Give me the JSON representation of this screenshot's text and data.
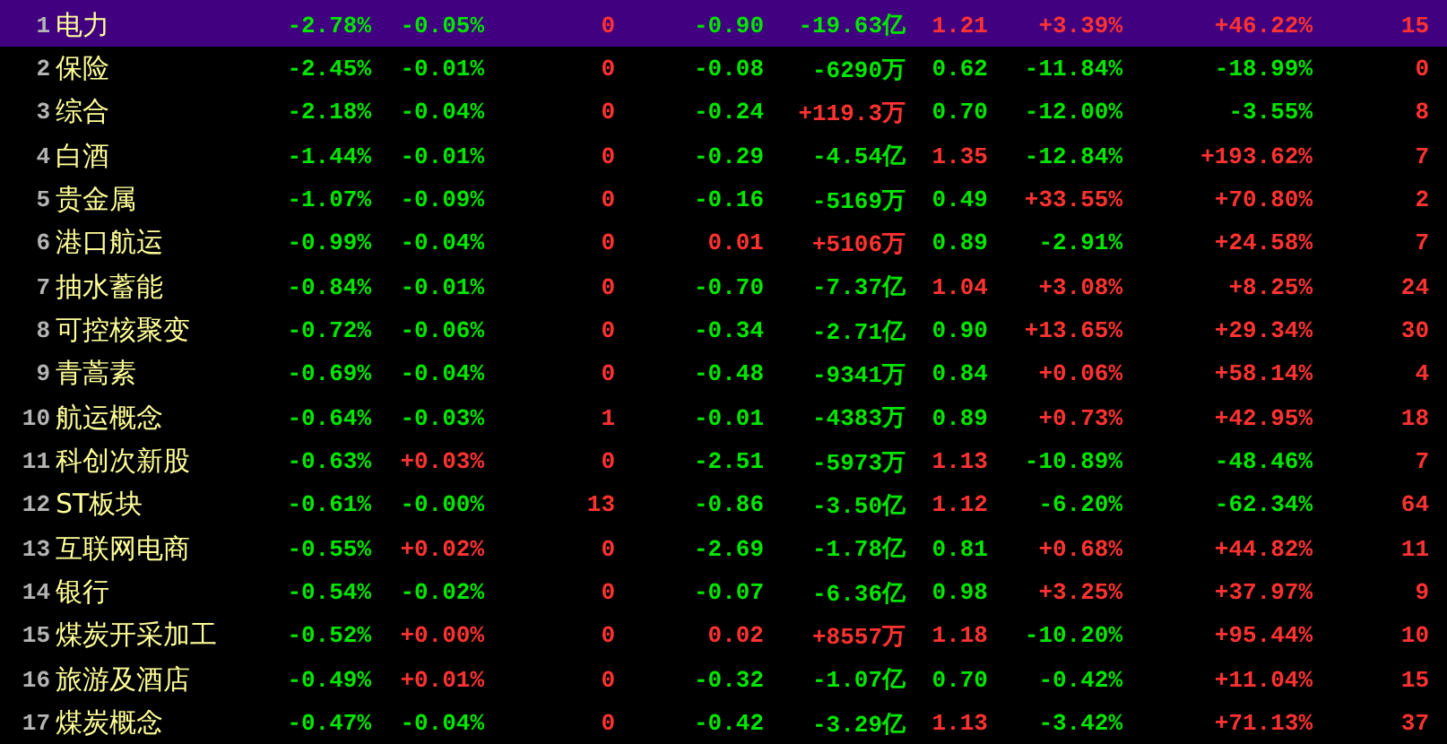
{
  "rows": [
    {
      "index": "1",
      "name": "电力",
      "selected": true,
      "cells": [
        {
          "text": "-2.78%",
          "color": "#00e600"
        },
        {
          "text": "-0.05%",
          "color": "#00e600"
        },
        {
          "text": "0",
          "color": "#ff3232"
        },
        {
          "text": "-0.90",
          "color": "#00e600"
        },
        {
          "text": "-19.63亿",
          "color": "#00e600"
        },
        {
          "text": "1.21",
          "color": "#ff3232"
        },
        {
          "text": "+3.39%",
          "color": "#ff3232"
        },
        {
          "text": "+46.22%",
          "color": "#ff3232"
        },
        {
          "text": "15",
          "color": "#ff3232"
        }
      ]
    },
    {
      "index": "2",
      "name": "保险",
      "selected": false,
      "cells": [
        {
          "text": "-2.45%",
          "color": "#00e600"
        },
        {
          "text": "-0.01%",
          "color": "#00e600"
        },
        {
          "text": "0",
          "color": "#ff3232"
        },
        {
          "text": "-0.08",
          "color": "#00e600"
        },
        {
          "text": "-6290万",
          "color": "#00e600"
        },
        {
          "text": "0.62",
          "color": "#00e600"
        },
        {
          "text": "-11.84%",
          "color": "#00e600"
        },
        {
          "text": "-18.99%",
          "color": "#00e600"
        },
        {
          "text": "0",
          "color": "#ff3232"
        }
      ]
    },
    {
      "index": "3",
      "name": "综合",
      "selected": false,
      "cells": [
        {
          "text": "-2.18%",
          "color": "#00e600"
        },
        {
          "text": "-0.04%",
          "color": "#00e600"
        },
        {
          "text": "0",
          "color": "#ff3232"
        },
        {
          "text": "-0.24",
          "color": "#00e600"
        },
        {
          "text": "+119.3万",
          "color": "#ff3232"
        },
        {
          "text": "0.70",
          "color": "#00e600"
        },
        {
          "text": "-12.00%",
          "color": "#00e600"
        },
        {
          "text": "-3.55%",
          "color": "#00e600"
        },
        {
          "text": "8",
          "color": "#ff3232"
        }
      ]
    },
    {
      "index": "4",
      "name": "白酒",
      "selected": false,
      "cells": [
        {
          "text": "-1.44%",
          "color": "#00e600"
        },
        {
          "text": "-0.01%",
          "color": "#00e600"
        },
        {
          "text": "0",
          "color": "#ff3232"
        },
        {
          "text": "-0.29",
          "color": "#00e600"
        },
        {
          "text": "-4.54亿",
          "color": "#00e600"
        },
        {
          "text": "1.35",
          "color": "#ff3232"
        },
        {
          "text": "-12.84%",
          "color": "#00e600"
        },
        {
          "text": "+193.62%",
          "color": "#ff3232"
        },
        {
          "text": "7",
          "color": "#ff3232"
        }
      ]
    },
    {
      "index": "5",
      "name": "贵金属",
      "selected": false,
      "cells": [
        {
          "text": "-1.07%",
          "color": "#00e600"
        },
        {
          "text": "-0.09%",
          "color": "#00e600"
        },
        {
          "text": "0",
          "color": "#ff3232"
        },
        {
          "text": "-0.16",
          "color": "#00e600"
        },
        {
          "text": "-5169万",
          "color": "#00e600"
        },
        {
          "text": "0.49",
          "color": "#00e600"
        },
        {
          "text": "+33.55%",
          "color": "#ff3232"
        },
        {
          "text": "+70.80%",
          "color": "#ff3232"
        },
        {
          "text": "2",
          "color": "#ff3232"
        }
      ]
    },
    {
      "index": "6",
      "name": "港口航运",
      "selected": false,
      "cells": [
        {
          "text": "-0.99%",
          "color": "#00e600"
        },
        {
          "text": "-0.04%",
          "color": "#00e600"
        },
        {
          "text": "0",
          "color": "#ff3232"
        },
        {
          "text": "0.01",
          "color": "#ff3232"
        },
        {
          "text": "+5106万",
          "color": "#ff3232"
        },
        {
          "text": "0.89",
          "color": "#00e600"
        },
        {
          "text": "-2.91%",
          "color": "#00e600"
        },
        {
          "text": "+24.58%",
          "color": "#ff3232"
        },
        {
          "text": "7",
          "color": "#ff3232"
        }
      ]
    },
    {
      "index": "7",
      "name": "抽水蓄能",
      "selected": false,
      "cells": [
        {
          "text": "-0.84%",
          "color": "#00e600"
        },
        {
          "text": "-0.01%",
          "color": "#00e600"
        },
        {
          "text": "0",
          "color": "#ff3232"
        },
        {
          "text": "-0.70",
          "color": "#00e600"
        },
        {
          "text": "-7.37亿",
          "color": "#00e600"
        },
        {
          "text": "1.04",
          "color": "#ff3232"
        },
        {
          "text": "+3.08%",
          "color": "#ff3232"
        },
        {
          "text": "+8.25%",
          "color": "#ff3232"
        },
        {
          "text": "24",
          "color": "#ff3232"
        }
      ]
    },
    {
      "index": "8",
      "name": "可控核聚变",
      "selected": false,
      "cells": [
        {
          "text": "-0.72%",
          "color": "#00e600"
        },
        {
          "text": "-0.06%",
          "color": "#00e600"
        },
        {
          "text": "0",
          "color": "#ff3232"
        },
        {
          "text": "-0.34",
          "color": "#00e600"
        },
        {
          "text": "-2.71亿",
          "color": "#00e600"
        },
        {
          "text": "0.90",
          "color": "#00e600"
        },
        {
          "text": "+13.65%",
          "color": "#ff3232"
        },
        {
          "text": "+29.34%",
          "color": "#ff3232"
        },
        {
          "text": "30",
          "color": "#ff3232"
        }
      ]
    },
    {
      "index": "9",
      "name": "青蒿素",
      "selected": false,
      "cells": [
        {
          "text": "-0.69%",
          "color": "#00e600"
        },
        {
          "text": "-0.04%",
          "color": "#00e600"
        },
        {
          "text": "0",
          "color": "#ff3232"
        },
        {
          "text": "-0.48",
          "color": "#00e600"
        },
        {
          "text": "-9341万",
          "color": "#00e600"
        },
        {
          "text": "0.84",
          "color": "#00e600"
        },
        {
          "text": "+0.06%",
          "color": "#ff3232"
        },
        {
          "text": "+58.14%",
          "color": "#ff3232"
        },
        {
          "text": "4",
          "color": "#ff3232"
        }
      ]
    },
    {
      "index": "10",
      "name": "航运概念",
      "selected": false,
      "cells": [
        {
          "text": "-0.64%",
          "color": "#00e600"
        },
        {
          "text": "-0.03%",
          "color": "#00e600"
        },
        {
          "text": "1",
          "color": "#ff3232"
        },
        {
          "text": "-0.01",
          "color": "#00e600"
        },
        {
          "text": "-4383万",
          "color": "#00e600"
        },
        {
          "text": "0.89",
          "color": "#00e600"
        },
        {
          "text": "+0.73%",
          "color": "#ff3232"
        },
        {
          "text": "+42.95%",
          "color": "#ff3232"
        },
        {
          "text": "18",
          "color": "#ff3232"
        }
      ]
    },
    {
      "index": "11",
      "name": "科创次新股",
      "selected": false,
      "cells": [
        {
          "text": "-0.63%",
          "color": "#00e600"
        },
        {
          "text": "+0.03%",
          "color": "#ff3232"
        },
        {
          "text": "0",
          "color": "#ff3232"
        },
        {
          "text": "-2.51",
          "color": "#00e600"
        },
        {
          "text": "-5973万",
          "color": "#00e600"
        },
        {
          "text": "1.13",
          "color": "#ff3232"
        },
        {
          "text": "-10.89%",
          "color": "#00e600"
        },
        {
          "text": "-48.46%",
          "color": "#00e600"
        },
        {
          "text": "7",
          "color": "#ff3232"
        }
      ]
    },
    {
      "index": "12",
      "name": "ST板块",
      "selected": false,
      "cells": [
        {
          "text": "-0.61%",
          "color": "#00e600"
        },
        {
          "text": "-0.00%",
          "color": "#00e600"
        },
        {
          "text": "13",
          "color": "#ff3232"
        },
        {
          "text": "-0.86",
          "color": "#00e600"
        },
        {
          "text": "-3.50亿",
          "color": "#00e600"
        },
        {
          "text": "1.12",
          "color": "#ff3232"
        },
        {
          "text": "-6.20%",
          "color": "#00e600"
        },
        {
          "text": "-62.34%",
          "color": "#00e600"
        },
        {
          "text": "64",
          "color": "#ff3232"
        }
      ]
    },
    {
      "index": "13",
      "name": "互联网电商",
      "selected": false,
      "cells": [
        {
          "text": "-0.55%",
          "color": "#00e600"
        },
        {
          "text": "+0.02%",
          "color": "#ff3232"
        },
        {
          "text": "0",
          "color": "#ff3232"
        },
        {
          "text": "-2.69",
          "color": "#00e600"
        },
        {
          "text": "-1.78亿",
          "color": "#00e600"
        },
        {
          "text": "0.81",
          "color": "#00e600"
        },
        {
          "text": "+0.68%",
          "color": "#ff3232"
        },
        {
          "text": "+44.82%",
          "color": "#ff3232"
        },
        {
          "text": "11",
          "color": "#ff3232"
        }
      ]
    },
    {
      "index": "14",
      "name": "银行",
      "selected": false,
      "cells": [
        {
          "text": "-0.54%",
          "color": "#00e600"
        },
        {
          "text": "-0.02%",
          "color": "#00e600"
        },
        {
          "text": "0",
          "color": "#ff3232"
        },
        {
          "text": "-0.07",
          "color": "#00e600"
        },
        {
          "text": "-6.36亿",
          "color": "#00e600"
        },
        {
          "text": "0.98",
          "color": "#00e600"
        },
        {
          "text": "+3.25%",
          "color": "#ff3232"
        },
        {
          "text": "+37.97%",
          "color": "#ff3232"
        },
        {
          "text": "9",
          "color": "#ff3232"
        }
      ]
    },
    {
      "index": "15",
      "name": "煤炭开采加工",
      "selected": false,
      "cells": [
        {
          "text": "-0.52%",
          "color": "#00e600"
        },
        {
          "text": "+0.00%",
          "color": "#ff3232"
        },
        {
          "text": "0",
          "color": "#ff3232"
        },
        {
          "text": "0.02",
          "color": "#ff3232"
        },
        {
          "text": "+8557万",
          "color": "#ff3232"
        },
        {
          "text": "1.18",
          "color": "#ff3232"
        },
        {
          "text": "-10.20%",
          "color": "#00e600"
        },
        {
          "text": "+95.44%",
          "color": "#ff3232"
        },
        {
          "text": "10",
          "color": "#ff3232"
        }
      ]
    },
    {
      "index": "16",
      "name": "旅游及酒店",
      "selected": false,
      "cells": [
        {
          "text": "-0.49%",
          "color": "#00e600"
        },
        {
          "text": "+0.01%",
          "color": "#ff3232"
        },
        {
          "text": "0",
          "color": "#ff3232"
        },
        {
          "text": "-0.32",
          "color": "#00e600"
        },
        {
          "text": "-1.07亿",
          "color": "#00e600"
        },
        {
          "text": "0.70",
          "color": "#00e600"
        },
        {
          "text": "-0.42%",
          "color": "#00e600"
        },
        {
          "text": "+11.04%",
          "color": "#ff3232"
        },
        {
          "text": "15",
          "color": "#ff3232"
        }
      ]
    },
    {
      "index": "17",
      "name": "煤炭概念",
      "selected": false,
      "cells": [
        {
          "text": "-0.47%",
          "color": "#00e600"
        },
        {
          "text": "-0.04%",
          "color": "#00e600"
        },
        {
          "text": "0",
          "color": "#ff3232"
        },
        {
          "text": "-0.42",
          "color": "#00e600"
        },
        {
          "text": "-3.29亿",
          "color": "#00e600"
        },
        {
          "text": "1.13",
          "color": "#ff3232"
        },
        {
          "text": "-3.42%",
          "color": "#00e600"
        },
        {
          "text": "+71.13%",
          "color": "#ff3232"
        },
        {
          "text": "37",
          "color": "#ff3232"
        }
      ]
    }
  ]
}
